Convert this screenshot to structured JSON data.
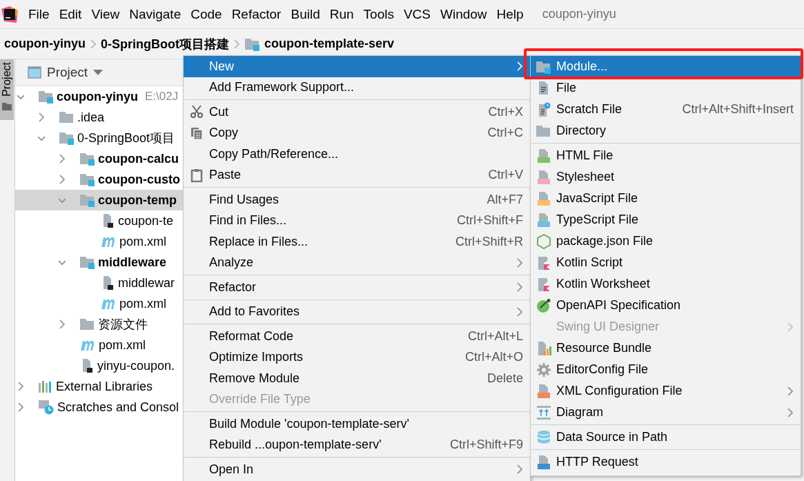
{
  "menu_bar": {
    "items": [
      "File",
      "Edit",
      "View",
      "Navigate",
      "Code",
      "Refactor",
      "Build",
      "Run",
      "Tools",
      "VCS",
      "Window",
      "Help"
    ],
    "title": "coupon-yinyu"
  },
  "breadcrumb": [
    {
      "label": "coupon-yinyu",
      "kind": "plain"
    },
    {
      "label": "0-SpringBoot项目搭建",
      "kind": "plain"
    },
    {
      "label": "coupon-template-serv",
      "kind": "module"
    }
  ],
  "side_strip": {
    "tab": {
      "label": "Project",
      "selected": true
    }
  },
  "project_panel": {
    "title": "Project",
    "tree": [
      {
        "label": "coupon-yinyu",
        "kind": "module",
        "bold": true,
        "hint": "E:\\02J",
        "expanded": true,
        "selected": false,
        "children": [
          {
            "label": ".idea",
            "kind": "folder",
            "bold": false,
            "expanded": false,
            "selected": false
          },
          {
            "label": "0-SpringBoot项目",
            "kind": "module",
            "bold": false,
            "expanded": true,
            "selected": false,
            "children": [
              {
                "label": "coupon-calcu",
                "kind": "module",
                "bold": true,
                "expanded": false,
                "selected": false
              },
              {
                "label": "coupon-custo",
                "kind": "module",
                "bold": true,
                "expanded": false,
                "selected": false
              },
              {
                "label": "coupon-temp",
                "kind": "module",
                "bold": true,
                "expanded": true,
                "selected": true,
                "children": [
                  {
                    "label": "coupon-te",
                    "kind": "iml",
                    "bold": false,
                    "selected": false
                  },
                  {
                    "label": "pom.xml",
                    "kind": "pom",
                    "bold": false,
                    "selected": false
                  }
                ]
              },
              {
                "label": "middleware",
                "kind": "module",
                "bold": true,
                "expanded": true,
                "selected": false,
                "children": [
                  {
                    "label": "middlewar",
                    "kind": "iml",
                    "bold": false,
                    "selected": false
                  },
                  {
                    "label": "pom.xml",
                    "kind": "pom",
                    "bold": false,
                    "selected": false
                  }
                ]
              },
              {
                "label": "资源文件",
                "kind": "folder",
                "bold": false,
                "expanded": false,
                "selected": false
              },
              {
                "label": "pom.xml",
                "kind": "pom",
                "bold": false,
                "selected": false
              },
              {
                "label": "yinyu-coupon.",
                "kind": "iml",
                "bold": false,
                "selected": false
              }
            ]
          }
        ]
      },
      {
        "label": "External Libraries",
        "kind": "libraries",
        "bold": false,
        "expanded": false,
        "selected": false
      },
      {
        "label": "Scratches and Consol",
        "kind": "scratches",
        "bold": false,
        "expanded": false,
        "selected": false
      }
    ]
  },
  "context_menu": [
    {
      "kind": "plain",
      "label": "New",
      "selected": true,
      "submenu": true
    },
    {
      "kind": "plain",
      "label": "Add Framework Support...",
      "selected": false
    },
    {
      "kind": "separator"
    },
    {
      "kind": "cut",
      "label": "Cut",
      "shortcut": "Ctrl+X",
      "selected": false
    },
    {
      "kind": "copy",
      "label": "Copy",
      "shortcut": "Ctrl+C",
      "selected": false
    },
    {
      "kind": "plain",
      "label": "Copy Path/Reference...",
      "selected": false
    },
    {
      "kind": "paste",
      "label": "Paste",
      "shortcut": "Ctrl+V",
      "selected": false
    },
    {
      "kind": "separator"
    },
    {
      "kind": "plain",
      "label": "Find Usages",
      "shortcut": "Alt+F7",
      "selected": false
    },
    {
      "kind": "plain",
      "label": "Find in Files...",
      "shortcut": "Ctrl+Shift+F",
      "selected": false
    },
    {
      "kind": "plain",
      "label": "Replace in Files...",
      "shortcut": "Ctrl+Shift+R",
      "selected": false
    },
    {
      "kind": "plain",
      "label": "Analyze",
      "selected": false,
      "submenu": true
    },
    {
      "kind": "separator"
    },
    {
      "kind": "plain",
      "label": "Refactor",
      "selected": false,
      "submenu": true
    },
    {
      "kind": "separator"
    },
    {
      "kind": "plain",
      "label": "Add to Favorites",
      "selected": false,
      "submenu": true
    },
    {
      "kind": "separator"
    },
    {
      "kind": "plain",
      "label": "Reformat Code",
      "shortcut": "Ctrl+Alt+L",
      "selected": false
    },
    {
      "kind": "plain",
      "label": "Optimize Imports",
      "shortcut": "Ctrl+Alt+O",
      "selected": false
    },
    {
      "kind": "plain",
      "label": "Remove Module",
      "shortcut": "Delete",
      "selected": false
    },
    {
      "kind": "plain",
      "label": "Override File Type",
      "selected": false,
      "disabled": true
    },
    {
      "kind": "separator"
    },
    {
      "kind": "plain",
      "label": "Build Module 'coupon-template-serv'",
      "selected": false
    },
    {
      "kind": "plain",
      "label": "Rebuild ...oupon-template-serv'",
      "shortcut": "Ctrl+Shift+F9",
      "selected": false
    },
    {
      "kind": "separator"
    },
    {
      "kind": "plain",
      "label": "Open In",
      "selected": false,
      "submenu": true
    }
  ],
  "new_submenu": [
    {
      "kind": "module",
      "label": "Module...",
      "selected": true,
      "annotated": true
    },
    {
      "kind": "file",
      "label": "File",
      "selected": false
    },
    {
      "kind": "scratch",
      "label": "Scratch File",
      "shortcut": "Ctrl+Alt+Shift+Insert",
      "selected": false
    },
    {
      "kind": "directory",
      "label": "Directory",
      "selected": false
    },
    {
      "kind": "separator"
    },
    {
      "kind": "html",
      "label": "HTML File",
      "selected": false
    },
    {
      "kind": "css",
      "label": "Stylesheet",
      "selected": false
    },
    {
      "kind": "js",
      "label": "JavaScript File",
      "selected": false
    },
    {
      "kind": "ts",
      "label": "TypeScript File",
      "selected": false
    },
    {
      "kind": "node",
      "label": "package.json File",
      "selected": false
    },
    {
      "kind": "kotlin",
      "label": "Kotlin Script",
      "selected": false
    },
    {
      "kind": "kotlin",
      "label": "Kotlin Worksheet",
      "selected": false
    },
    {
      "kind": "openapi",
      "label": "OpenAPI Specification",
      "selected": false
    },
    {
      "kind": "plain",
      "label": "Swing UI Designer",
      "selected": false,
      "disabled": true,
      "submenu": true
    },
    {
      "kind": "bundle",
      "label": "Resource Bundle",
      "selected": false
    },
    {
      "kind": "gear",
      "label": "EditorConfig File",
      "selected": false
    },
    {
      "kind": "xml",
      "label": "XML Configuration File",
      "selected": false,
      "submenu": true
    },
    {
      "kind": "diagram",
      "label": "Diagram",
      "selected": false,
      "submenu": true
    },
    {
      "kind": "separator"
    },
    {
      "kind": "database",
      "label": "Data Source in Path",
      "selected": false
    },
    {
      "kind": "separator"
    },
    {
      "kind": "api",
      "label": "HTTP Request",
      "selected": false
    }
  ]
}
